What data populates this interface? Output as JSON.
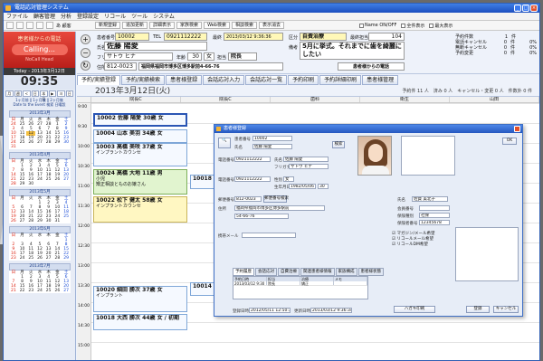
{
  "window": {
    "title": "電話応対管理システム"
  },
  "menu": [
    "ファイル",
    "顧客管理",
    "分析",
    "登録設定",
    "リコール",
    "ツール",
    "システム"
  ],
  "toolbar": {
    "buttons": [
      "新規登録",
      "追加更新",
      "詳細表示",
      "家族検索",
      "Web検索",
      "相談検索",
      "表示消去"
    ],
    "checks": [
      "Name ON/OFF",
      "全件表示",
      "最大表示"
    ],
    "prefix": "あ 顧客"
  },
  "sidebar": {
    "call_title": "患者様からの電話",
    "call_button": "Calling...",
    "call_sub": "NoCall Head",
    "today": "Today - 2013年3月12日",
    "clock": "09:35",
    "nav": [
      "月",
      "週",
      "<",
      "日",
      "本日",
      "▶",
      "ヨ",
      "日"
    ],
    "nav2": "1ヶ月前 ‖ 1ヶ月後 ‖ 2ヶ月後\nDate to the Event 検索 日曜設",
    "weekdays": [
      "日",
      "月",
      "火",
      "水",
      "木",
      "金",
      "土"
    ],
    "months": [
      {
        "title": "2013年3月",
        "rows": [
          [
            "24",
            "25",
            "26",
            "27",
            "28",
            "1",
            "2"
          ],
          [
            "3",
            "4",
            "5",
            "6",
            "7",
            "8",
            "9"
          ],
          [
            "10",
            "11",
            "12",
            "13",
            "14",
            "15",
            "16"
          ],
          [
            "17",
            "18",
            "19",
            "20",
            "21",
            "22",
            "23"
          ],
          [
            "24",
            "25",
            "26",
            "27",
            "28",
            "29",
            "30"
          ],
          [
            "31",
            "",
            "",
            "",
            "",
            "",
            ""
          ]
        ],
        "today": "12"
      },
      {
        "title": "2013年4月",
        "rows": [
          [
            "",
            "1",
            "2",
            "3",
            "4",
            "5",
            "6"
          ],
          [
            "7",
            "8",
            "9",
            "10",
            "11",
            "12",
            "13"
          ],
          [
            "14",
            "15",
            "16",
            "17",
            "18",
            "19",
            "20"
          ],
          [
            "21",
            "22",
            "23",
            "24",
            "25",
            "26",
            "27"
          ],
          [
            "28",
            "29",
            "30",
            "",
            "",
            "",
            ""
          ]
        ]
      },
      {
        "title": "2013年5月",
        "rows": [
          [
            "",
            "",
            "",
            "1",
            "2",
            "3",
            "4"
          ],
          [
            "5",
            "6",
            "7",
            "8",
            "9",
            "10",
            "11"
          ],
          [
            "12",
            "13",
            "14",
            "15",
            "16",
            "17",
            "18"
          ],
          [
            "19",
            "20",
            "21",
            "22",
            "23",
            "24",
            "25"
          ],
          [
            "26",
            "27",
            "28",
            "29",
            "30",
            "31",
            ""
          ]
        ]
      },
      {
        "title": "2013年6月",
        "rows": [
          [
            "",
            "",
            "",
            "",
            "",
            "",
            "1"
          ],
          [
            "2",
            "3",
            "4",
            "5",
            "6",
            "7",
            "8"
          ],
          [
            "9",
            "10",
            "11",
            "12",
            "13",
            "14",
            "15"
          ],
          [
            "16",
            "17",
            "18",
            "19",
            "20",
            "21",
            "22"
          ],
          [
            "23",
            "24",
            "25",
            "26",
            "27",
            "28",
            "29"
          ]
        ]
      },
      {
        "title": "2013年7月",
        "rows": [
          [
            "",
            "1",
            "2",
            "3",
            "4",
            "5",
            "6"
          ],
          [
            "7",
            "8",
            "9",
            "10",
            "11",
            "12",
            "13"
          ],
          [
            "14",
            "15",
            "16",
            "17",
            "18",
            "19",
            "20"
          ],
          [
            "21",
            "22",
            "23",
            "24",
            "25",
            "26",
            "27"
          ]
        ]
      }
    ]
  },
  "header": {
    "patient_no_label": "患者番号",
    "patient_no": "10002",
    "tel_label": "TEL",
    "tel": "0921112222",
    "datetime_label": "最終",
    "datetime": "2013/03/12 9:36:36",
    "category_label": "区分",
    "category": "自費治療",
    "doc_label": "最終担当",
    "doc": "104",
    "name_label": "氏名",
    "name": "佐藤 陽愛",
    "kana_label": "フリガナ",
    "kana": "サトウ ヒナ",
    "age_label": "年齢",
    "age": "30",
    "sex": "女",
    "rank_label": "担当",
    "rank": "院長",
    "zip_label": "住所",
    "zip": "812-0023",
    "address": "福岡県福岡市博多区博多駅前4-66-76",
    "note_label": "備考",
    "note": "5月に挙式。それまでに歯を綺麗にしたい",
    "source": "患者様からの電話",
    "stats": [
      {
        "label": "予約件数",
        "value": "1",
        "unit": "件"
      },
      {
        "label": "電話キャンセル",
        "value": "0",
        "unit": "件"
      },
      {
        "label": "無断キャンセル",
        "value": "0",
        "unit": "件"
      },
      {
        "label": "予約変更",
        "value": "0",
        "unit": "件"
      }
    ],
    "pct": [
      "0%",
      "0%",
      "0%"
    ]
  },
  "tabs": [
    "予約/実績登録",
    "予約/実績検索",
    "患者様登録",
    "会話応対入力",
    "会話応対一覧",
    "予約印刷",
    "予約詳細印刷",
    "患者様管理"
  ],
  "schedule": {
    "date": "2013年3月12日(火)",
    "summary": "予約件 11 人　済み 0 人　キャンセル・変更 0 人　件数外 0 件",
    "columns": [
      "院長C",
      "院長C",
      "歯科",
      "衛生",
      "山田"
    ],
    "times": [
      "9:00",
      "9:30",
      "10:00",
      "10:30",
      "11:00",
      "11:30",
      "12:00",
      "12:30",
      "13:00",
      "13:30",
      "14:00",
      "14:30",
      "15:00"
    ],
    "appointments": [
      {
        "name": "10002 佐藤 陽愛 30歳 女",
        "note": "",
        "cls": "sel",
        "col": "0",
        "slot": "0.5",
        "h": "0.7"
      },
      {
        "name": "10004 山本 美羽 34歳 女",
        "note": "",
        "cls": "",
        "col": "0",
        "slot": "1.3",
        "h": "0.7"
      },
      {
        "name": "10003 高橋 美咲 37歳 女",
        "note": "インプラントカウンセ",
        "cls": "",
        "col": "0",
        "slot": "2.0",
        "h": "1.2"
      },
      {
        "name": "10024 高橋 大地 11歳 男",
        "note": "小児\n矯正相談とものお嬢さん",
        "cls": "grn",
        "col": "0",
        "slot": "3.3",
        "h": "1.3"
      },
      {
        "name": "10022 松下 健太 58歳 女",
        "note": "インプラントカウンセ",
        "cls": "yel2",
        "col": "0",
        "slot": "4.7",
        "h": "1.3"
      },
      {
        "name": "10018 斎藤",
        "note": "",
        "cls": "",
        "col": "1",
        "slot": "3.6",
        "h": "0.7"
      },
      {
        "name": "10020 細田 勝次 37歳 女",
        "note": "インプラント",
        "cls": "",
        "col": "0",
        "slot": "9.2",
        "h": "1.3"
      },
      {
        "name": "10018 大西 勝次 44歳 女 / 初期",
        "note": "",
        "cls": "",
        "col": "0",
        "slot": "10.6",
        "h": "0.8"
      },
      {
        "name": "10014 村上",
        "note": "",
        "cls": "",
        "col": "1",
        "slot": "9.0",
        "h": "0.7"
      }
    ]
  },
  "dialog": {
    "title": "患者様登録",
    "patient_no": "10002",
    "tel": "0921112222",
    "name": "佐藤 陽愛",
    "kana": "サトウ ヒナ",
    "sex": "女",
    "birth": "1982/05/06",
    "age": "30",
    "zip": "812-0023",
    "address": "福岡県福岡市博多区博多駅前",
    "address2": "54-66-76",
    "email": "",
    "right_fields": [
      {
        "label": "会員番号",
        "value": ""
      },
      {
        "label": "保険種別",
        "value": "社保"
      },
      {
        "label": "保険者番号",
        "value": "12345678"
      }
    ],
    "name_right": "佐賀 美北子",
    "checks": [
      "マガジン/メール希望",
      "リコールメール希望",
      "リコールDM希望"
    ],
    "created": "2012/05/11 12:50:30",
    "updated": "2013/03/12 9:36:34",
    "buttons": [
      "登録",
      "キャンセル"
    ],
    "tabs": [
      "予約履歴",
      "会話応対",
      "自費治療",
      "関連患者様情報",
      "家族構成",
      "患者様状態"
    ],
    "grid_headers": [
      "予約日時",
      "担当",
      "治療",
      "メモ"
    ],
    "grid_rows": [
      [
        "2013/03/12 9:30",
        "院長",
        "矯正",
        ""
      ]
    ]
  }
}
